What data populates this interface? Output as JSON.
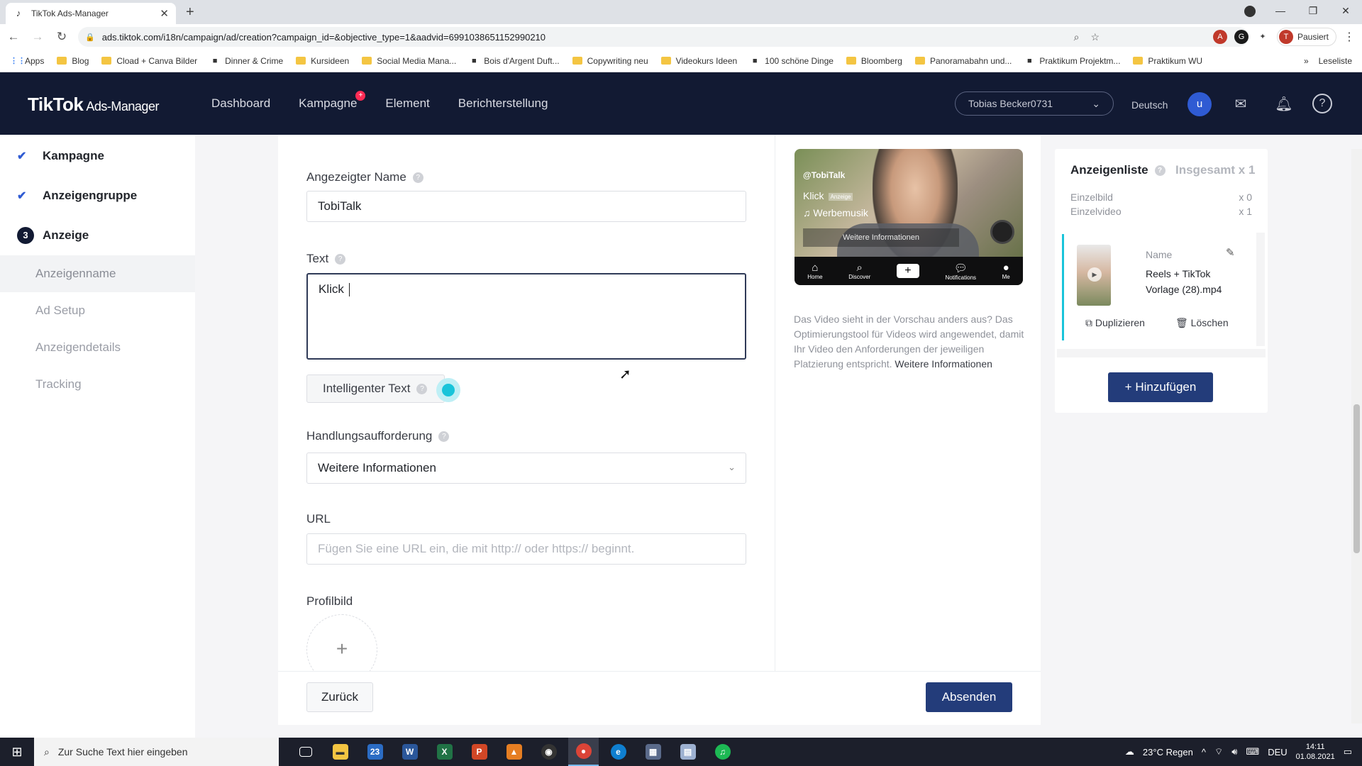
{
  "browser": {
    "tab_title": "TikTok Ads-Manager",
    "url": "ads.tiktok.com/i18n/campaign/ad/creation?campaign_id=&objective_type=1&aadvid=6991038651152990210",
    "profile_status": "Pausiert",
    "profile_initial": "T",
    "bookmarks": [
      {
        "label": "Apps",
        "icon": "apps-grid-icon"
      },
      {
        "label": "Blog",
        "icon": "folder-icon"
      },
      {
        "label": "Cload + Canva Bilder",
        "icon": "folder-icon"
      },
      {
        "label": "Dinner & Crime",
        "icon": "site-icon"
      },
      {
        "label": "Kursideen",
        "icon": "folder-icon"
      },
      {
        "label": "Social Media Mana...",
        "icon": "folder-icon"
      },
      {
        "label": "Bois d'Argent Duft...",
        "icon": "site-icon"
      },
      {
        "label": "Copywriting neu",
        "icon": "folder-icon"
      },
      {
        "label": "Videokurs Ideen",
        "icon": "folder-icon"
      },
      {
        "label": "100 schöne Dinge",
        "icon": "site-icon"
      },
      {
        "label": "Bloomberg",
        "icon": "folder-icon"
      },
      {
        "label": "Panoramabahn und...",
        "icon": "folder-icon"
      },
      {
        "label": "Praktikum Projektm...",
        "icon": "site-icon"
      },
      {
        "label": "Praktikum WU",
        "icon": "folder-icon"
      }
    ],
    "reading_list": "Leseliste",
    "more": "»"
  },
  "header": {
    "logo": "TikTok",
    "logo_sub": "Ads-Manager",
    "nav": [
      "Dashboard",
      "Kampagne",
      "Element",
      "Berichterstellung"
    ],
    "account": "Tobias Becker0731",
    "language": "Deutsch",
    "user_initial": "u"
  },
  "sidebar": {
    "steps": [
      {
        "label": "Kampagne",
        "state": "done"
      },
      {
        "label": "Anzeigengruppe",
        "state": "done"
      },
      {
        "label": "Anzeige",
        "state": "current",
        "number": "3"
      }
    ],
    "substeps": [
      "Anzeigenname",
      "Ad Setup",
      "Anzeigendetails",
      "Tracking"
    ],
    "active_substep": "Anzeigenname"
  },
  "form": {
    "display_name_label": "Angezeigter Name",
    "display_name_value": "TobiTalk",
    "text_label": "Text",
    "text_value": "Klick ",
    "smart_text_label": "Intelligenter Text",
    "cta_label": "Handlungsaufforderung",
    "cta_value": "Weitere Informationen",
    "url_label": "URL",
    "url_placeholder": "Fügen Sie eine URL ein, die mit http:// oder https:// beginnt.",
    "profile_image_label": "Profilbild",
    "back_button": "Zurück",
    "submit_button": "Absenden"
  },
  "preview": {
    "handle": "@TobiTalk",
    "ad_text": "Klick",
    "ad_tag": "Anzeige",
    "music": "♫ Werbemusik",
    "cta": "Weitere Informationen",
    "nav": [
      "Home",
      "Discover",
      "",
      "Notifications",
      "Me"
    ],
    "note": "Das Video sieht in der Vorschau anders aus? Das Optimierungstool für Videos wird angewendet, damit Ihr Video den Anforderungen der jeweiligen Platzierung entspricht.",
    "note_link": "Weitere Informationen"
  },
  "ad_list": {
    "title": "Anzeigenliste",
    "total": "Insgesamt x 1",
    "single_image_label": "Einzelbild",
    "single_image_count": "x 0",
    "single_video_label": "Einzelvideo",
    "single_video_count": "x 1",
    "item_name_label": "Name",
    "item_name": "Reels + TikTok Vorlage (28).mp4",
    "duplicate": "Duplizieren",
    "delete": "Löschen",
    "add_button": "+ Hinzufügen"
  },
  "taskbar": {
    "search_placeholder": "Zur Suche Text hier eingeben",
    "weather": "23°C  Regen",
    "lang": "DEU",
    "time": "14:11",
    "date": "01.08.2021",
    "mail_badge": "23"
  }
}
